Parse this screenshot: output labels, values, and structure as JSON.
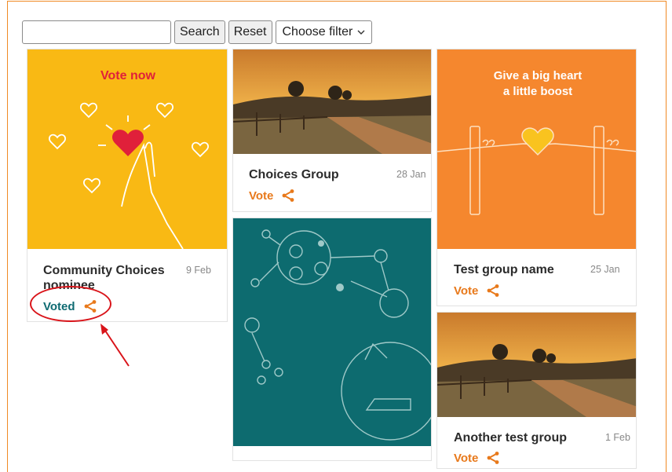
{
  "toolbar": {
    "search_value": "",
    "search_label": "Search",
    "reset_label": "Reset",
    "filter_label": "Choose filter"
  },
  "cards": [
    {
      "title": "Community Choices nominee",
      "date": "9 Feb",
      "vote_label": "Voted",
      "image_text": "Vote now"
    },
    {
      "title": "Choices Group",
      "date": "28 Jan",
      "vote_label": "Vote"
    },
    {
      "title": "Test group name",
      "date": "25 Jan",
      "vote_label": "Vote",
      "image_text_1": "Give a big heart",
      "image_text_2": "a little boost"
    },
    {
      "title": "Another test group",
      "date": "1 Feb",
      "vote_label": "Vote"
    }
  ],
  "colors": {
    "accent": "#e8791b",
    "voted": "#0f6b72",
    "yellow": "#f9b914",
    "orange": "#f5872e",
    "teal": "#0d6b6f",
    "annotation": "#d9141a"
  }
}
